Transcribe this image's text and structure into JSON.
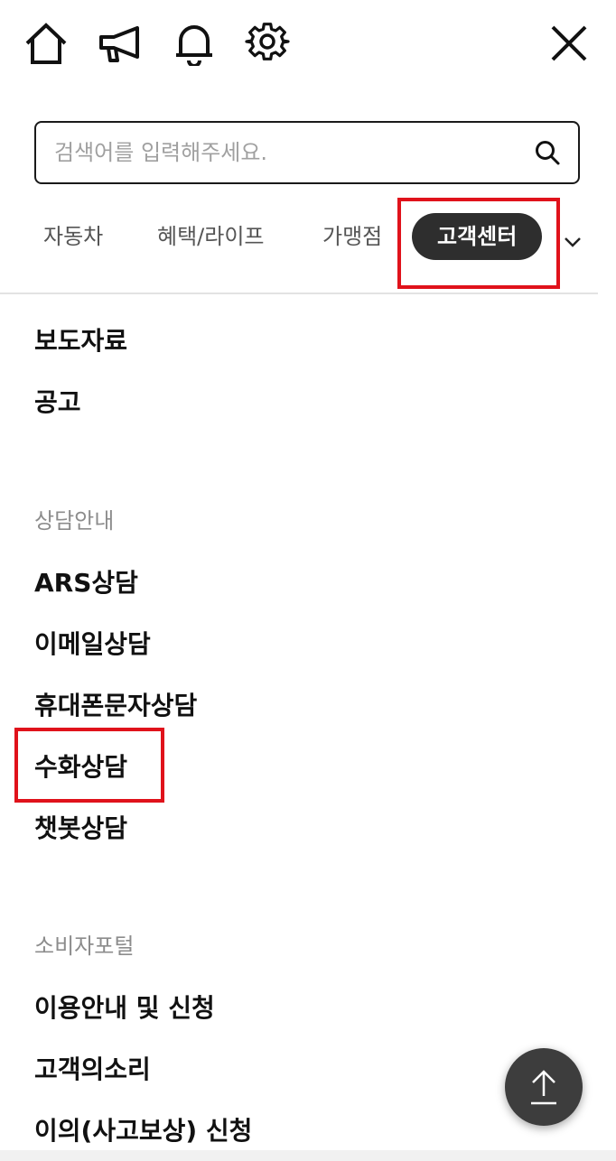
{
  "header": {
    "icons": [
      "home-icon",
      "megaphone-icon",
      "bell-icon",
      "gear-icon",
      "close-icon"
    ]
  },
  "search": {
    "placeholder": "검색어를 입력해주세요.",
    "value": ""
  },
  "tabs": [
    {
      "label": "자동차",
      "active": false
    },
    {
      "label": "혜택/라이프",
      "active": false
    },
    {
      "label": "가맹점",
      "active": false
    },
    {
      "label": "고객센터",
      "active": true
    }
  ],
  "menu": {
    "top_items": [
      "보도자료",
      "공고"
    ],
    "sections": [
      {
        "title": "상담안내",
        "items": [
          "ARS상담",
          "이메일상담",
          "휴대폰문자상담",
          "수화상담",
          "챗봇상담"
        ]
      },
      {
        "title": "소비자포털",
        "items": [
          "이용안내 및 신청",
          "고객의소리",
          "이의(사고보상) 신청"
        ]
      }
    ]
  },
  "colors": {
    "active_tab_bg": "#2e2e2e",
    "highlight": "#e0121b",
    "section_title": "#8c8c8c",
    "scroll_top_bg": "#3d3d3d"
  }
}
